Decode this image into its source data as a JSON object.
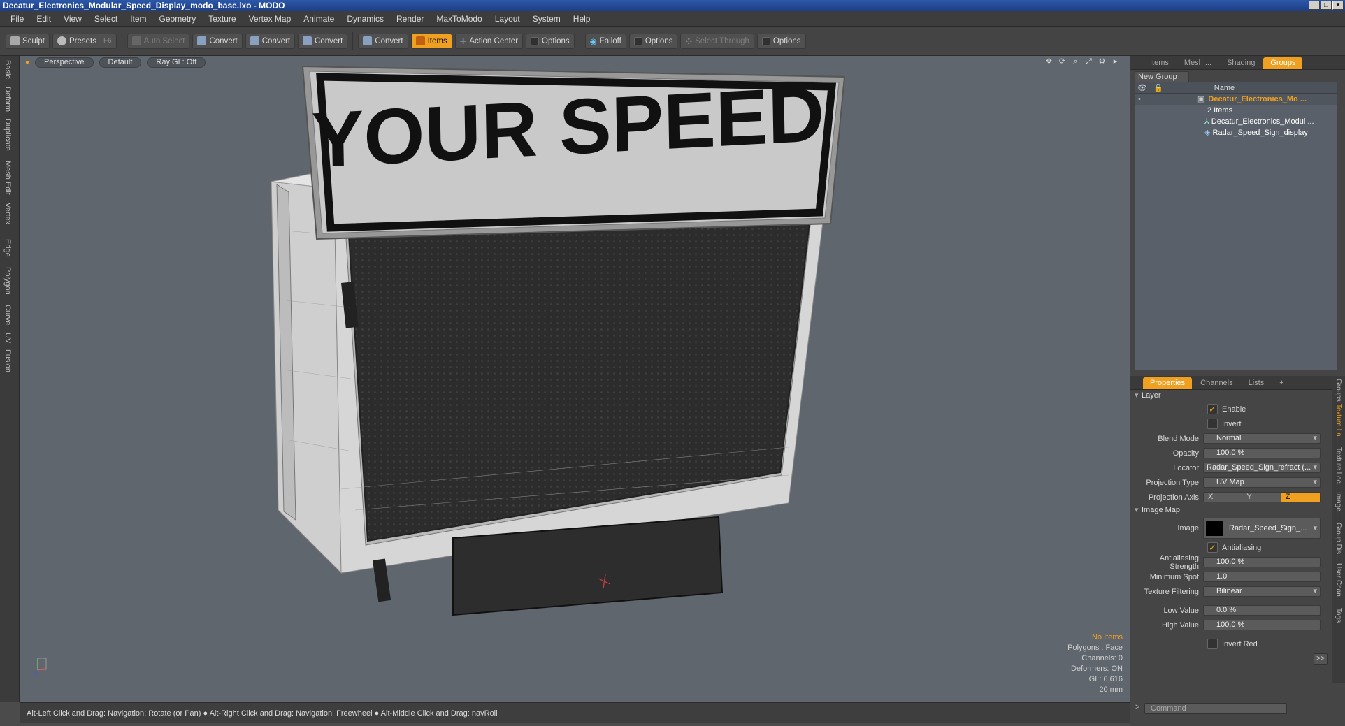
{
  "window": {
    "title": "Decatur_Electronics_Modular_Speed_Display_modo_base.lxo - MODO"
  },
  "menu": [
    "File",
    "Edit",
    "View",
    "Select",
    "Item",
    "Geometry",
    "Texture",
    "Vertex Map",
    "Animate",
    "Dynamics",
    "Render",
    "MaxToModo",
    "Layout",
    "System",
    "Help"
  ],
  "toolbar": {
    "sculpt": "Sculpt",
    "presets": "Presets",
    "presets_key": "F6",
    "auto_select": "Auto Select",
    "convert": "Convert",
    "items": "Items",
    "action_center": "Action Center",
    "options": "Options",
    "falloff": "Falloff",
    "select_through": "Select Through"
  },
  "left_tabs": [
    "Basic",
    "Deform",
    "Duplicate",
    "Mesh Edit",
    "Vertex",
    "Edge",
    "Polygon",
    "Curve",
    "UV",
    "Fusion"
  ],
  "viewport": {
    "view": "Perspective",
    "style": "Default",
    "raygl": "Ray GL: Off",
    "sign_text": "YOUR SPEED",
    "stats": {
      "selection": "No Items",
      "polygons": "Polygons : Face",
      "channels": "Channels: 0",
      "deformers": "Deformers: ON",
      "gl": "GL: 6,616",
      "scale": "20 mm"
    }
  },
  "status": "Alt-Left Click and Drag: Navigation: Rotate (or Pan) ● Alt-Right Click and Drag: Navigation: Freewheel ● Alt-Middle Click and Drag: navRoll",
  "groups_panel": {
    "tabs": [
      "Items",
      "Mesh ...",
      "Shading",
      "Groups"
    ],
    "new_group": "New Group",
    "col_name": "Name",
    "group_name": "Decatur_Electronics_Mo ...",
    "group_count": "2 Items",
    "children": [
      "Decatur_Electronics_Modul ...",
      "Radar_Speed_Sign_display"
    ]
  },
  "properties": {
    "tabs": [
      "Properties",
      "Channels",
      "Lists",
      "+"
    ],
    "layer": "Layer",
    "enable": "Enable",
    "invert": "Invert",
    "blend_label": "Blend Mode",
    "blend": "Normal",
    "opacity_label": "Opacity",
    "opacity": "100.0 %",
    "locator_label": "Locator",
    "locator": "Radar_Speed_Sign_refract (...",
    "proj_type_label": "Projection Type",
    "proj_type": "UV Map",
    "proj_axis_label": "Projection Axis",
    "axes": [
      "X",
      "Y",
      "Z"
    ],
    "image_map": "Image Map",
    "image_label": "Image",
    "image": "Radar_Speed_Sign_...",
    "antialiasing": "Antialiasing",
    "aa_strength_label": "Antialiasing Strength",
    "aa_strength": "100.0 %",
    "min_spot_label": "Minimum Spot",
    "min_spot": "1.0",
    "filter_label": "Texture Filtering",
    "filter": "Bilinear",
    "low_label": "Low Value",
    "low": "0.0 %",
    "high_label": "High Value",
    "high": "100.0 %",
    "invert_red": "Invert Red",
    "more": ">>"
  },
  "side_tabs": [
    "Groups",
    "Texture La...",
    "Texture Loc...",
    "Image...",
    "Group Dis...",
    "User Chan...",
    "Tags"
  ],
  "command_placeholder": "Command"
}
